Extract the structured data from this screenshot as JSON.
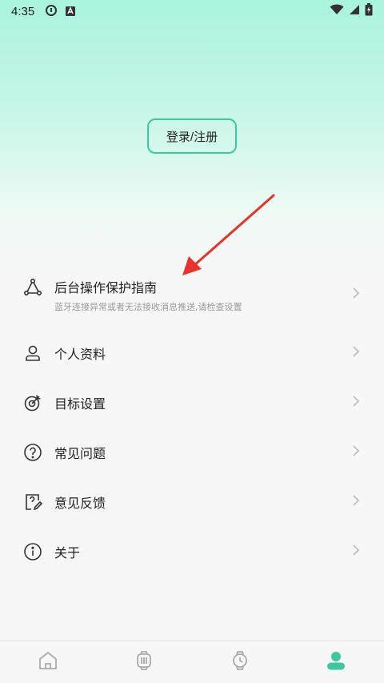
{
  "status": {
    "time": "4:35"
  },
  "auth": {
    "login_label": "登录/注册"
  },
  "menu": [
    {
      "label": "后台操作保护指南",
      "subtitle": "蓝牙连接异常或者无法接收消息推送,请检查设置",
      "icon": "share-nodes-icon"
    },
    {
      "label": "个人资料",
      "icon": "person-icon"
    },
    {
      "label": "目标设置",
      "icon": "target-icon"
    },
    {
      "label": "常见问题",
      "icon": "question-circle-icon"
    },
    {
      "label": "意见反馈",
      "icon": "feedback-edit-icon"
    },
    {
      "label": "关于",
      "icon": "info-circle-icon"
    }
  ],
  "tabs": [
    {
      "icon": "home-icon",
      "active": false
    },
    {
      "icon": "watch-settings-icon",
      "active": false
    },
    {
      "icon": "watch-icon",
      "active": false
    },
    {
      "icon": "profile-icon",
      "active": true
    }
  ],
  "colors": {
    "accent": "#3ec8a0",
    "active_tab": "#3ec8a0",
    "arrow": "#e8322c"
  }
}
